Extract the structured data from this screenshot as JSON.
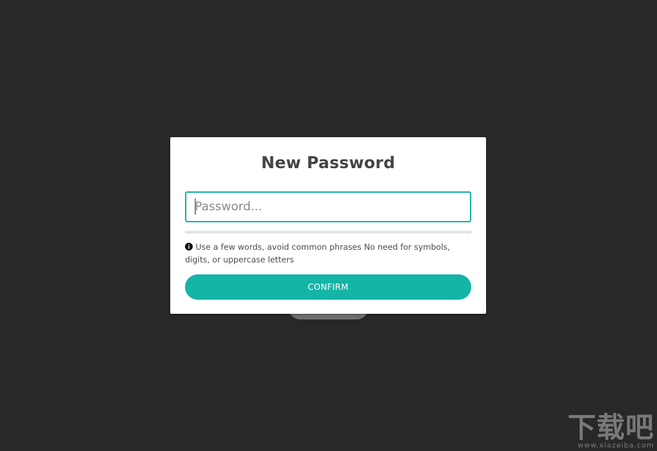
{
  "background_color": "#282828",
  "dialog": {
    "title": "New Password",
    "password_field": {
      "value": "",
      "placeholder": "Password..."
    },
    "strength": {
      "level": 0
    },
    "hint_icon": "info-icon",
    "hint_text": "Use a few words, avoid common phrases No need for symbols, digits, or uppercase letters",
    "confirm_label": "CONFIRM",
    "accent_color": "#14b5a7"
  },
  "watermark": {
    "logo_text": "下载吧",
    "url_text": "www.xiazaiba.com"
  }
}
